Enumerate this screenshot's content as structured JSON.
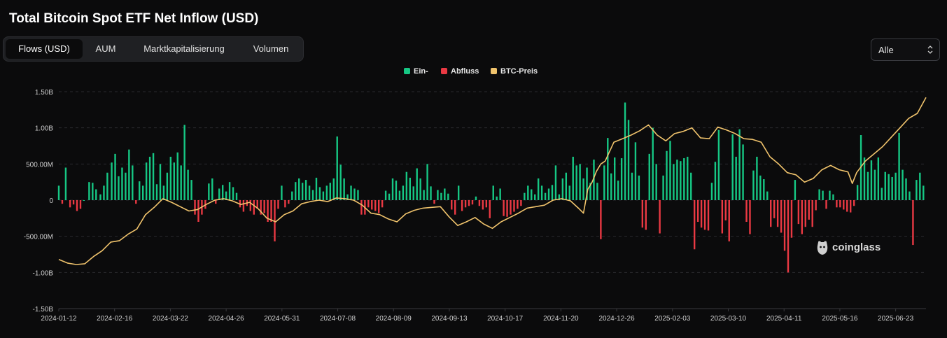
{
  "title": "Total Bitcoin Spot ETF Net Inflow (USD)",
  "tabs": [
    {
      "label": "Flows (USD)",
      "active": true
    },
    {
      "label": "AUM",
      "active": false
    },
    {
      "label": "Marktkapitalisierung",
      "active": false
    },
    {
      "label": "Volumen",
      "active": false
    }
  ],
  "range_select": {
    "value": "Alle"
  },
  "legend": [
    {
      "label": "Ein-",
      "color": "#16c784"
    },
    {
      "label": "Abfluss",
      "color": "#ea3943"
    },
    {
      "label": "BTC-Preis",
      "color": "#f0c36c"
    }
  ],
  "watermark": "coinglass",
  "chart_data": {
    "type": "bar",
    "title": "Total Bitcoin Spot ETF Net Inflow (USD)",
    "y_axis_ticks": [
      "1.50B",
      "1.00B",
      "500.00M",
      "0",
      "-500.00M",
      "-1.00B",
      "-1.50B"
    ],
    "ylim": [
      -1500000000,
      1500000000
    ],
    "x_axis_ticks": [
      "2024-01-12",
      "2024-02-16",
      "2024-03-22",
      "2024-04-26",
      "2024-05-31",
      "2024-07-08",
      "2024-08-09",
      "2024-09-13",
      "2024-10-17",
      "2024-11-20",
      "2024-12-26",
      "2025-02-03",
      "2025-03-10",
      "2025-04-11",
      "2025-05-16",
      "2025-06-23"
    ],
    "grid": true,
    "legend_position": "top-center",
    "series": [
      {
        "name": "Ein-",
        "color": "#16c784",
        "kind": "bar"
      },
      {
        "name": "Abfluss",
        "color": "#ea3943",
        "kind": "bar"
      },
      {
        "name": "BTC-Preis",
        "color": "#f0c36c",
        "kind": "line"
      }
    ],
    "flow_points": [
      [
        0.0,
        200
      ],
      [
        0.004,
        -50
      ],
      [
        0.008,
        450
      ],
      [
        0.013,
        -100
      ],
      [
        0.017,
        -60
      ],
      [
        0.021,
        -150
      ],
      [
        0.025,
        -120
      ],
      [
        0.029,
        0
      ],
      [
        0.035,
        250
      ],
      [
        0.039,
        240
      ],
      [
        0.043,
        150
      ],
      [
        0.048,
        80
      ],
      [
        0.052,
        200
      ],
      [
        0.056,
        380
      ],
      [
        0.061,
        520
      ],
      [
        0.065,
        640
      ],
      [
        0.069,
        330
      ],
      [
        0.073,
        450
      ],
      [
        0.077,
        380
      ],
      [
        0.081,
        700
      ],
      [
        0.085,
        480
      ],
      [
        0.089,
        -50
      ],
      [
        0.093,
        260
      ],
      [
        0.097,
        200
      ],
      [
        0.101,
        520
      ],
      [
        0.105,
        600
      ],
      [
        0.109,
        650
      ],
      [
        0.113,
        220
      ],
      [
        0.117,
        500
      ],
      [
        0.121,
        200
      ],
      [
        0.125,
        380
      ],
      [
        0.129,
        600
      ],
      [
        0.133,
        520
      ],
      [
        0.137,
        660
      ],
      [
        0.141,
        480
      ],
      [
        0.145,
        1040
      ],
      [
        0.149,
        420
      ],
      [
        0.153,
        280
      ],
      [
        0.157,
        -200
      ],
      [
        0.161,
        -300
      ],
      [
        0.165,
        -200
      ],
      [
        0.169,
        -120
      ],
      [
        0.173,
        230
      ],
      [
        0.177,
        300
      ],
      [
        0.181,
        -50
      ],
      [
        0.185,
        160
      ],
      [
        0.189,
        210
      ],
      [
        0.193,
        120
      ],
      [
        0.197,
        250
      ],
      [
        0.201,
        180
      ],
      [
        0.205,
        100
      ],
      [
        0.209,
        -100
      ],
      [
        0.213,
        -160
      ],
      [
        0.217,
        -80
      ],
      [
        0.221,
        -150
      ],
      [
        0.225,
        -200
      ],
      [
        0.229,
        -120
      ],
      [
        0.233,
        -200
      ],
      [
        0.237,
        -180
      ],
      [
        0.241,
        -300
      ],
      [
        0.245,
        -300
      ],
      [
        0.249,
        -570
      ],
      [
        0.253,
        -120
      ],
      [
        0.257,
        200
      ],
      [
        0.261,
        -100
      ],
      [
        0.265,
        -50
      ],
      [
        0.269,
        120
      ],
      [
        0.273,
        250
      ],
      [
        0.277,
        300
      ],
      [
        0.281,
        240
      ],
      [
        0.285,
        280
      ],
      [
        0.289,
        200
      ],
      [
        0.293,
        140
      ],
      [
        0.297,
        310
      ],
      [
        0.301,
        180
      ],
      [
        0.305,
        120
      ],
      [
        0.309,
        200
      ],
      [
        0.313,
        240
      ],
      [
        0.317,
        300
      ],
      [
        0.321,
        880
      ],
      [
        0.325,
        490
      ],
      [
        0.329,
        300
      ],
      [
        0.333,
        80
      ],
      [
        0.337,
        200
      ],
      [
        0.341,
        160
      ],
      [
        0.345,
        140
      ],
      [
        0.349,
        -200
      ],
      [
        0.353,
        -200
      ],
      [
        0.357,
        -100
      ],
      [
        0.361,
        -130
      ],
      [
        0.365,
        -150
      ],
      [
        0.369,
        -180
      ],
      [
        0.373,
        -100
      ],
      [
        0.377,
        130
      ],
      [
        0.381,
        90
      ],
      [
        0.385,
        300
      ],
      [
        0.389,
        270
      ],
      [
        0.393,
        130
      ],
      [
        0.397,
        200
      ],
      [
        0.401,
        390
      ],
      [
        0.405,
        310
      ],
      [
        0.409,
        190
      ],
      [
        0.413,
        440
      ],
      [
        0.417,
        300
      ],
      [
        0.421,
        140
      ],
      [
        0.425,
        500
      ],
      [
        0.429,
        190
      ],
      [
        0.433,
        -50
      ],
      [
        0.437,
        140
      ],
      [
        0.441,
        100
      ],
      [
        0.445,
        160
      ],
      [
        0.449,
        90
      ],
      [
        0.453,
        -130
      ],
      [
        0.457,
        -200
      ],
      [
        0.461,
        200
      ],
      [
        0.465,
        -150
      ],
      [
        0.469,
        -100
      ],
      [
        0.473,
        -80
      ],
      [
        0.477,
        -60
      ],
      [
        0.481,
        50
      ],
      [
        0.485,
        -80
      ],
      [
        0.489,
        -130
      ],
      [
        0.493,
        -100
      ],
      [
        0.497,
        -250
      ],
      [
        0.501,
        200
      ],
      [
        0.505,
        50
      ],
      [
        0.509,
        160
      ],
      [
        0.513,
        -220
      ],
      [
        0.517,
        -230
      ],
      [
        0.521,
        -200
      ],
      [
        0.525,
        -160
      ],
      [
        0.529,
        -120
      ],
      [
        0.533,
        -80
      ],
      [
        0.537,
        100
      ],
      [
        0.541,
        200
      ],
      [
        0.545,
        150
      ],
      [
        0.549,
        80
      ],
      [
        0.553,
        300
      ],
      [
        0.557,
        200
      ],
      [
        0.561,
        100
      ],
      [
        0.565,
        160
      ],
      [
        0.569,
        210
      ],
      [
        0.573,
        480
      ],
      [
        0.577,
        80
      ],
      [
        0.581,
        300
      ],
      [
        0.585,
        380
      ],
      [
        0.589,
        200
      ],
      [
        0.593,
        600
      ],
      [
        0.597,
        480
      ],
      [
        0.601,
        500
      ],
      [
        0.605,
        300
      ],
      [
        0.609,
        450
      ],
      [
        0.613,
        240
      ],
      [
        0.617,
        560
      ],
      [
        0.621,
        240
      ],
      [
        0.625,
        -540
      ],
      [
        0.629,
        480
      ],
      [
        0.633,
        860
      ],
      [
        0.637,
        370
      ],
      [
        0.641,
        590
      ],
      [
        0.645,
        270
      ],
      [
        0.649,
        580
      ],
      [
        0.653,
        1350
      ],
      [
        0.657,
        1110
      ],
      [
        0.661,
        380
      ],
      [
        0.665,
        800
      ],
      [
        0.669,
        340
      ],
      [
        0.673,
        -380
      ],
      [
        0.677,
        -410
      ],
      [
        0.681,
        640
      ],
      [
        0.685,
        1000
      ],
      [
        0.689,
        500
      ],
      [
        0.693,
        -460
      ],
      [
        0.697,
        340
      ],
      [
        0.701,
        680
      ],
      [
        0.705,
        820
      ],
      [
        0.709,
        500
      ],
      [
        0.713,
        560
      ],
      [
        0.717,
        540
      ],
      [
        0.721,
        580
      ],
      [
        0.725,
        600
      ],
      [
        0.729,
        380
      ],
      [
        0.733,
        -680
      ],
      [
        0.737,
        -300
      ],
      [
        0.741,
        -380
      ],
      [
        0.745,
        -410
      ],
      [
        0.749,
        -420
      ],
      [
        0.753,
        240
      ],
      [
        0.757,
        530
      ],
      [
        0.761,
        970
      ],
      [
        0.765,
        -460
      ],
      [
        0.769,
        -280
      ],
      [
        0.773,
        -570
      ],
      [
        0.777,
        910
      ],
      [
        0.781,
        600
      ],
      [
        0.785,
        980
      ],
      [
        0.789,
        770
      ],
      [
        0.793,
        -300
      ],
      [
        0.797,
        -470
      ],
      [
        0.801,
        410
      ],
      [
        0.805,
        600
      ],
      [
        0.809,
        340
      ],
      [
        0.813,
        290
      ],
      [
        0.817,
        120
      ],
      [
        0.821,
        -370
      ],
      [
        0.825,
        -250
      ],
      [
        0.829,
        -370
      ],
      [
        0.833,
        -450
      ],
      [
        0.837,
        -700
      ],
      [
        0.841,
        -1000
      ],
      [
        0.845,
        -520
      ],
      [
        0.849,
        280
      ],
      [
        0.853,
        -330
      ],
      [
        0.857,
        -470
      ],
      [
        0.861,
        -370
      ],
      [
        0.865,
        -270
      ],
      [
        0.869,
        -370
      ],
      [
        0.873,
        -140
      ],
      [
        0.877,
        150
      ],
      [
        0.881,
        130
      ],
      [
        0.885,
        -120
      ],
      [
        0.889,
        130
      ],
      [
        0.893,
        80
      ],
      [
        0.897,
        -100
      ],
      [
        0.901,
        -100
      ],
      [
        0.905,
        -130
      ],
      [
        0.909,
        -160
      ],
      [
        0.913,
        -170
      ],
      [
        0.917,
        -80
      ],
      [
        0.921,
        210
      ],
      [
        0.925,
        900
      ],
      [
        0.929,
        590
      ],
      [
        0.933,
        390
      ],
      [
        0.937,
        550
      ],
      [
        0.941,
        420
      ],
      [
        0.945,
        590
      ],
      [
        0.949,
        170
      ],
      [
        0.953,
        390
      ],
      [
        0.957,
        360
      ],
      [
        0.961,
        320
      ],
      [
        0.965,
        380
      ],
      [
        0.969,
        930
      ],
      [
        0.973,
        420
      ],
      [
        0.977,
        300
      ],
      [
        0.981,
        120
      ],
      [
        0.985,
        -620
      ],
      [
        0.989,
        280
      ],
      [
        0.993,
        380
      ],
      [
        0.997,
        200
      ]
    ],
    "btc_price_line": [
      [
        0.0,
        -820
      ],
      [
        0.01,
        -870
      ],
      [
        0.02,
        -890
      ],
      [
        0.03,
        -880
      ],
      [
        0.04,
        -780
      ],
      [
        0.05,
        -700
      ],
      [
        0.06,
        -580
      ],
      [
        0.07,
        -560
      ],
      [
        0.08,
        -470
      ],
      [
        0.09,
        -400
      ],
      [
        0.1,
        -200
      ],
      [
        0.11,
        -100
      ],
      [
        0.12,
        20
      ],
      [
        0.13,
        -30
      ],
      [
        0.14,
        -90
      ],
      [
        0.15,
        -150
      ],
      [
        0.16,
        -130
      ],
      [
        0.17,
        -60
      ],
      [
        0.18,
        0
      ],
      [
        0.19,
        20
      ],
      [
        0.2,
        -10
      ],
      [
        0.21,
        -60
      ],
      [
        0.22,
        -30
      ],
      [
        0.23,
        -120
      ],
      [
        0.24,
        -250
      ],
      [
        0.25,
        -300
      ],
      [
        0.26,
        -200
      ],
      [
        0.27,
        -150
      ],
      [
        0.28,
        -50
      ],
      [
        0.29,
        -20
      ],
      [
        0.3,
        0
      ],
      [
        0.31,
        -20
      ],
      [
        0.32,
        30
      ],
      [
        0.33,
        20
      ],
      [
        0.34,
        0
      ],
      [
        0.35,
        -70
      ],
      [
        0.36,
        -180
      ],
      [
        0.37,
        -200
      ],
      [
        0.38,
        -260
      ],
      [
        0.39,
        -300
      ],
      [
        0.4,
        -190
      ],
      [
        0.41,
        -140
      ],
      [
        0.42,
        -110
      ],
      [
        0.43,
        -100
      ],
      [
        0.44,
        -90
      ],
      [
        0.45,
        -230
      ],
      [
        0.46,
        -350
      ],
      [
        0.47,
        -300
      ],
      [
        0.48,
        -240
      ],
      [
        0.49,
        -330
      ],
      [
        0.5,
        -390
      ],
      [
        0.51,
        -300
      ],
      [
        0.52,
        -240
      ],
      [
        0.53,
        -180
      ],
      [
        0.54,
        -110
      ],
      [
        0.55,
        -90
      ],
      [
        0.56,
        -70
      ],
      [
        0.57,
        0
      ],
      [
        0.58,
        20
      ],
      [
        0.59,
        -10
      ],
      [
        0.6,
        -120
      ],
      [
        0.605,
        -180
      ],
      [
        0.61,
        150
      ],
      [
        0.615,
        250
      ],
      [
        0.62,
        400
      ],
      [
        0.625,
        500
      ],
      [
        0.63,
        540
      ],
      [
        0.64,
        800
      ],
      [
        0.65,
        850
      ],
      [
        0.66,
        900
      ],
      [
        0.67,
        960
      ],
      [
        0.68,
        1040
      ],
      [
        0.69,
        900
      ],
      [
        0.7,
        820
      ],
      [
        0.71,
        920
      ],
      [
        0.72,
        950
      ],
      [
        0.73,
        1000
      ],
      [
        0.74,
        860
      ],
      [
        0.75,
        850
      ],
      [
        0.76,
        1010
      ],
      [
        0.77,
        970
      ],
      [
        0.78,
        920
      ],
      [
        0.79,
        850
      ],
      [
        0.8,
        840
      ],
      [
        0.81,
        800
      ],
      [
        0.82,
        600
      ],
      [
        0.83,
        500
      ],
      [
        0.84,
        380
      ],
      [
        0.85,
        350
      ],
      [
        0.86,
        250
      ],
      [
        0.87,
        300
      ],
      [
        0.88,
        420
      ],
      [
        0.89,
        480
      ],
      [
        0.9,
        420
      ],
      [
        0.91,
        390
      ],
      [
        0.915,
        230
      ],
      [
        0.92,
        380
      ],
      [
        0.93,
        540
      ],
      [
        0.94,
        640
      ],
      [
        0.95,
        740
      ],
      [
        0.96,
        870
      ],
      [
        0.97,
        1000
      ],
      [
        0.98,
        1130
      ],
      [
        0.99,
        1200
      ],
      [
        1.0,
        1420
      ]
    ]
  }
}
